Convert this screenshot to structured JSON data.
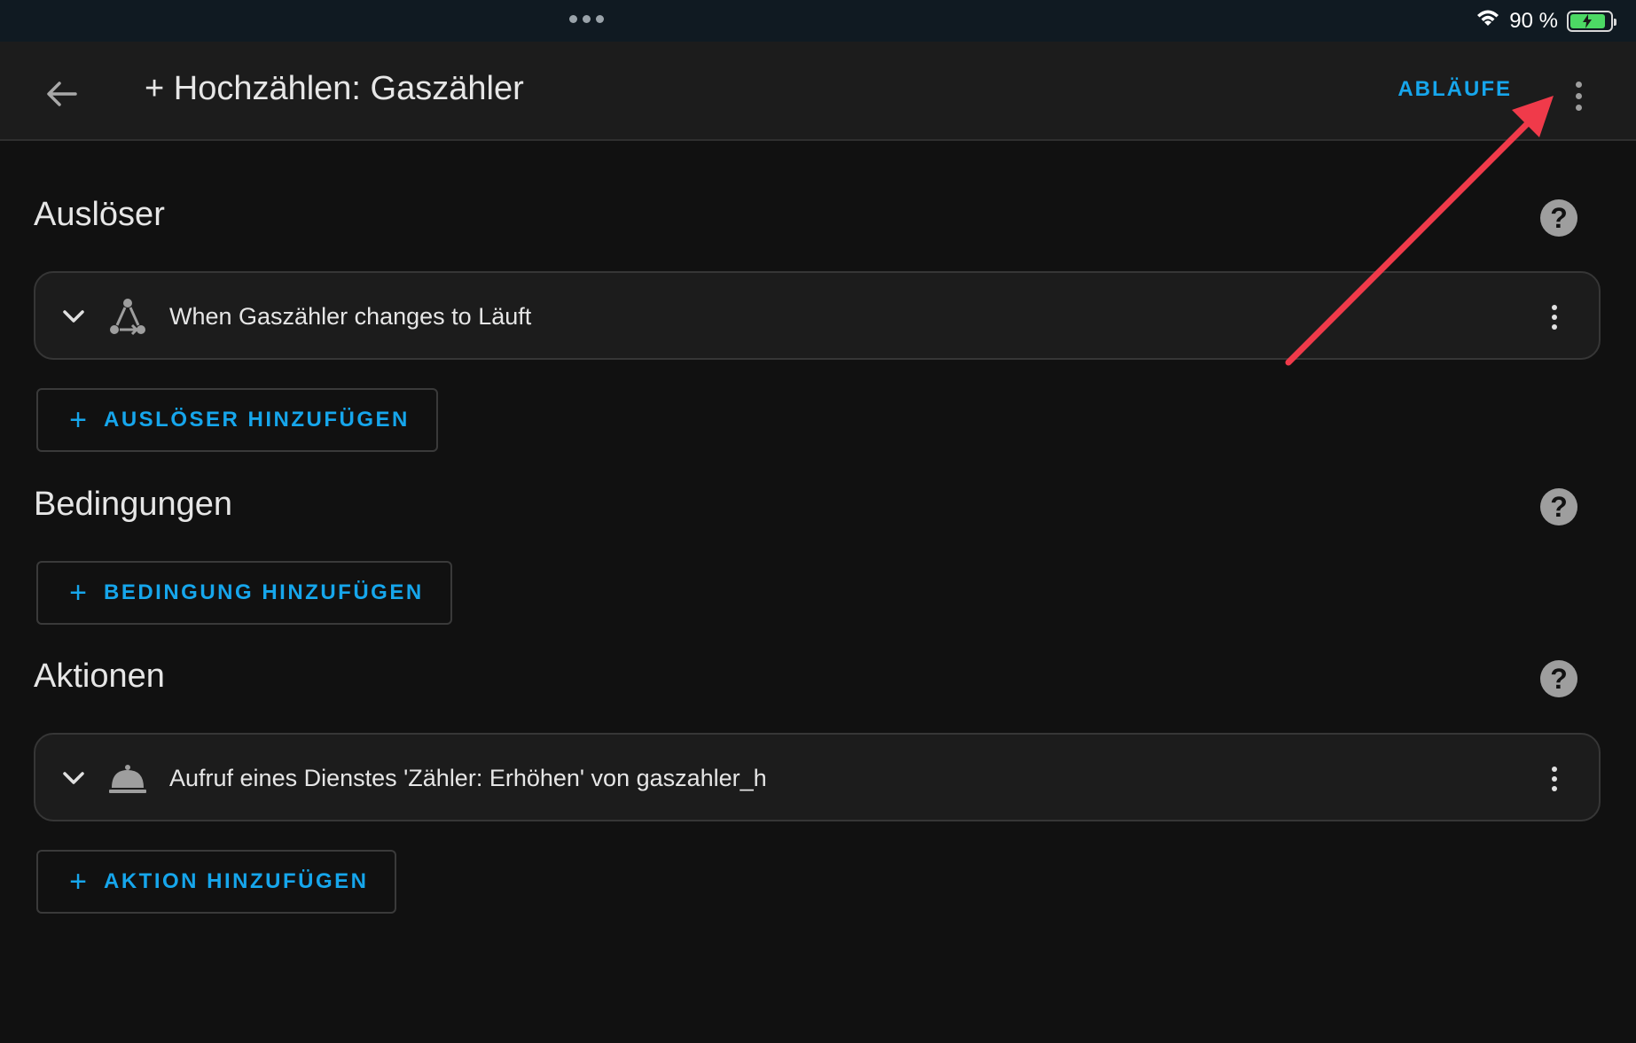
{
  "status_bar": {
    "battery_text": "90 %",
    "wifi_icon": "wifi-icon",
    "battery_icon": "battery-charging-icon",
    "accent_battery": "#4cd964"
  },
  "app_bar": {
    "back_icon": "arrow-left-icon",
    "title": "+ Hochzählen: Gaszähler",
    "ablaufe_label": "ABLÄUFE",
    "overflow_icon": "dots-vertical-icon"
  },
  "sections": {
    "triggers": {
      "title": "Auslöser",
      "help_icon": "?",
      "items": [
        {
          "icon": "state-trigger-icon",
          "label": "When Gaszähler changes to Läuft"
        }
      ],
      "add_label": "AUSLÖSER HINZUFÜGEN"
    },
    "conditions": {
      "title": "Bedingungen",
      "help_icon": "?",
      "add_label": "BEDINGUNG HINZUFÜGEN"
    },
    "actions": {
      "title": "Aktionen",
      "help_icon": "?",
      "items": [
        {
          "icon": "service-bell-icon",
          "label": "Aufruf eines Dienstes 'Zähler: Erhöhen' von gaszahler_h"
        }
      ],
      "add_label": "AKTION HINZUFÜGEN"
    }
  },
  "colors": {
    "accent": "#16a6ec",
    "background": "#111111",
    "card": "#1c1c1c",
    "annotation": "#f03a4a"
  }
}
